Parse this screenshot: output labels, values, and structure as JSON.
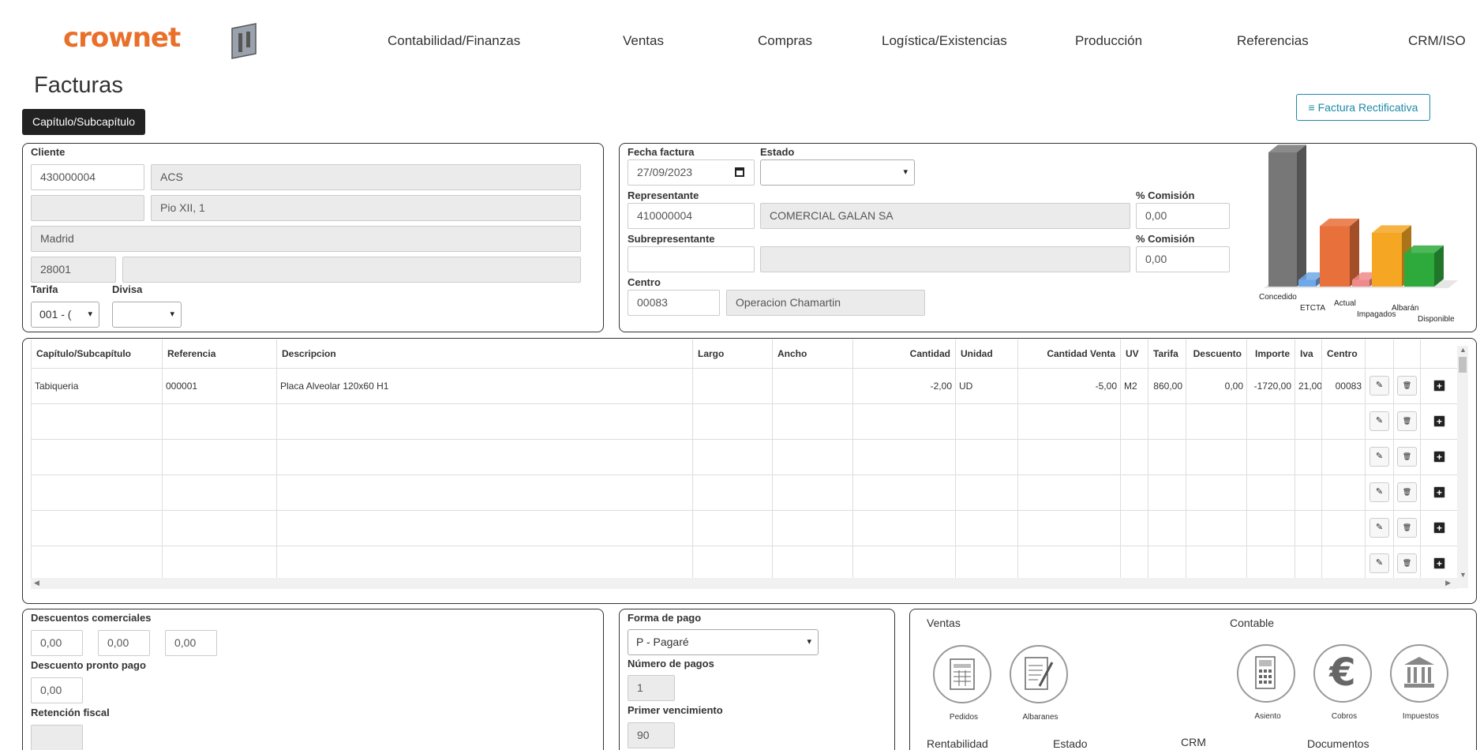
{
  "brand": {
    "logo_text": "crownet",
    "accent": "#e8702a"
  },
  "nav": [
    "Contabilidad/Finanzas",
    "Ventas",
    "Compras",
    "Logística/Existencias",
    "Producción",
    "Referencias",
    "CRM/ISO"
  ],
  "page": {
    "title": "Facturas",
    "chapter_button": "Capítulo/Subcapítulo",
    "rectify_button": "Factura Rectificativa"
  },
  "client": {
    "label": "Cliente",
    "code": "430000004",
    "name": "ACS",
    "address_code": "",
    "address": "Pio XII, 1",
    "city": "Madrid",
    "postal_code": "28001",
    "province": "",
    "tarifa_label": "Tarifa",
    "tarifa_value": "001 - (",
    "divisa_label": "Divisa",
    "divisa_value": ""
  },
  "invoice": {
    "fecha_label": "Fecha factura",
    "fecha_value": "27/09/2023",
    "estado_label": "Estado",
    "estado_value": "",
    "representante_label": "Representante",
    "representante_code": "410000004",
    "representante_name": "COMERCIAL GALAN SA",
    "comision_label": "% Comisión",
    "comision_value": "0,00",
    "subrep_label": "Subrepresentante",
    "subrep_code": "",
    "subrep_name": "",
    "comision2_label": "% Comisión",
    "comision2_value": "0,00",
    "centro_label": "Centro",
    "centro_code": "00083",
    "centro_name": "Operacion Chamartin"
  },
  "chart_data": {
    "type": "bar",
    "categories": [
      "Concedido",
      "ETCTA",
      "Actual",
      "Impagados",
      "Albarán",
      "Disponible"
    ],
    "colors": [
      "#777777",
      "#6fa8e8",
      "#e8703a",
      "#f08a8a",
      "#f5a623",
      "#2eaa3c"
    ],
    "values": [
      100,
      5,
      45,
      5,
      40,
      25
    ]
  },
  "table": {
    "headers": [
      "Capítulo/Subcapítulo",
      "Referencia",
      "Descripcion",
      "Largo",
      "Ancho",
      "Cantidad",
      "Unidad",
      "Cantidad Venta",
      "UV",
      "Tarifa",
      "Descuento",
      "Importe",
      "Iva",
      "Centro"
    ],
    "rows": [
      [
        "Tabiqueria",
        "000001",
        "Placa Alveolar  120x60 H1",
        "",
        "",
        "-2,00",
        "UD",
        "-5,00",
        "M2",
        "860,00",
        "0,00",
        "-1720,00",
        "21,00",
        "00083"
      ],
      [
        "",
        "",
        "",
        "",
        "",
        "",
        "",
        "",
        "",
        "",
        "",
        "",
        "",
        ""
      ],
      [
        "",
        "",
        "",
        "",
        "",
        "",
        "",
        "",
        "",
        "",
        "",
        "",
        "",
        ""
      ],
      [
        "",
        "",
        "",
        "",
        "",
        "",
        "",
        "",
        "",
        "",
        "",
        "",
        "",
        ""
      ],
      [
        "",
        "",
        "",
        "",
        "",
        "",
        "",
        "",
        "",
        "",
        "",
        "",
        "",
        ""
      ],
      [
        "",
        "",
        "",
        "",
        "",
        "",
        "",
        "",
        "",
        "",
        "",
        "",
        "",
        ""
      ]
    ]
  },
  "discounts": {
    "comerciales_label": "Descuentos comerciales",
    "d1": "0,00",
    "d2": "0,00",
    "d3": "0,00",
    "pronto_label": "Descuento pronto pago",
    "pronto_value": "0,00",
    "retencion_label": "Retención fiscal",
    "retencion_value": ""
  },
  "payment": {
    "forma_label": "Forma de pago",
    "forma_value": "P - Pagaré",
    "numero_label": "Número de pagos",
    "numero_value": "1",
    "primer_label": "Primer vencimiento",
    "primer_value": "90"
  },
  "links": {
    "ventas_label": "Ventas",
    "contable_label": "Contable",
    "pedidos": "Pedidos",
    "albaranes": "Albaranes",
    "asiento": "Asiento",
    "cobros": "Cobros",
    "impuestos": "Impuestos",
    "rentabilidad": "Rentabilidad",
    "estado": "Estado",
    "crm": "CRM",
    "documentos": "Documentos"
  }
}
